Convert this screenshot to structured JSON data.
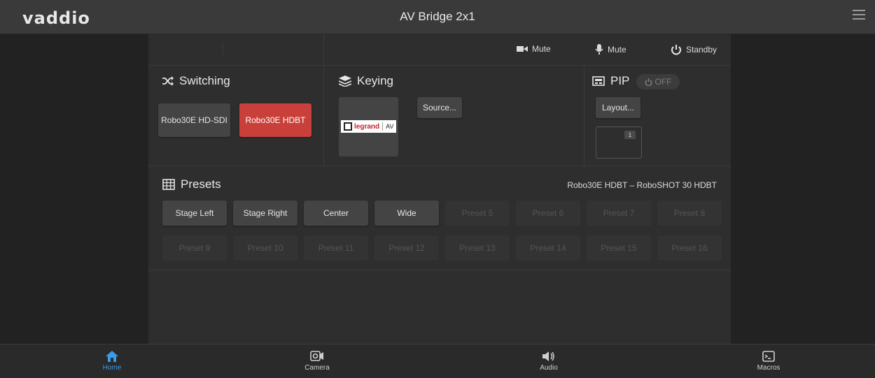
{
  "header": {
    "logo": "vaddio",
    "title": "AV Bridge 2x1"
  },
  "toolbar": {
    "video_mute": "Mute",
    "audio_mute": "Mute",
    "standby": "Standby"
  },
  "switching": {
    "title": "Switching",
    "sources": [
      {
        "label": "Robo30E HD-SDI",
        "active": false
      },
      {
        "label": "Robo30E HDBT",
        "active": true
      }
    ]
  },
  "keying": {
    "title": "Keying",
    "source_button": "Source...",
    "logo_text": "legrand",
    "logo_suffix": "AV"
  },
  "pip": {
    "title": "PIP",
    "toggle": "OFF",
    "layout_button": "Layout...",
    "window_number": "1"
  },
  "presets": {
    "title": "Presets",
    "camera_info": "Robo30E HDBT – RoboSHOT 30 HDBT",
    "items": [
      "Stage Left",
      "Stage Right",
      "Center",
      "Wide",
      "Preset 5",
      "Preset 6",
      "Preset 7",
      "Preset 8",
      "Preset 9",
      "Preset 10",
      "Preset 11",
      "Preset 12",
      "Preset 13",
      "Preset 14",
      "Preset 15",
      "Preset 16"
    ],
    "enabled_count": 4
  },
  "nav": {
    "home": "Home",
    "camera": "Camera",
    "audio": "Audio",
    "macros": "Macros",
    "active_color": "#3a9be8"
  },
  "colors": {
    "accent_red": "#c9403a",
    "panel": "#2e2e2e",
    "header": "#3a3a3a"
  }
}
